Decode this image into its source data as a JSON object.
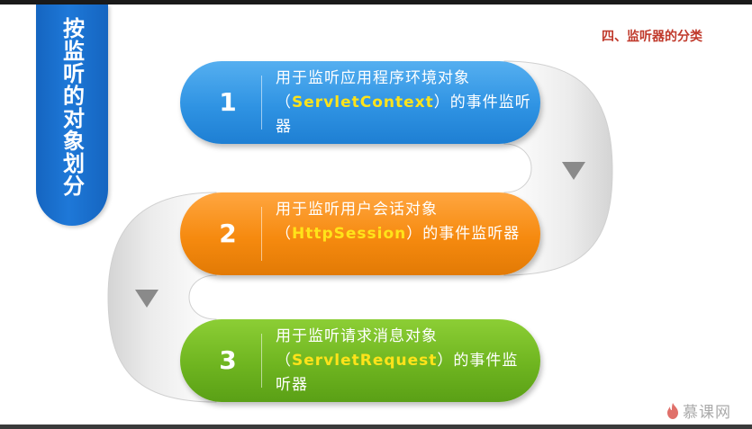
{
  "side_tab": {
    "title": "按监听的对象划分"
  },
  "heading": "四、监听器的分类",
  "steps": [
    {
      "number": "1",
      "pre": "用于监听应用程序环境对象（",
      "keyword": "ServletContext",
      "post": "）的事件监听器",
      "color": "#2f93e3"
    },
    {
      "number": "2",
      "pre": "用于监听用户会话对象（",
      "keyword": "HttpSession",
      "post": "）的事件监听器",
      "color": "#f68a0f"
    },
    {
      "number": "3",
      "pre": "用于监听请求消息对象（",
      "keyword": "ServletRequest",
      "post": "）的事件监听器",
      "color": "#6fb520"
    }
  ],
  "watermark": {
    "text": "慕课网",
    "icon": "flame-icon"
  }
}
